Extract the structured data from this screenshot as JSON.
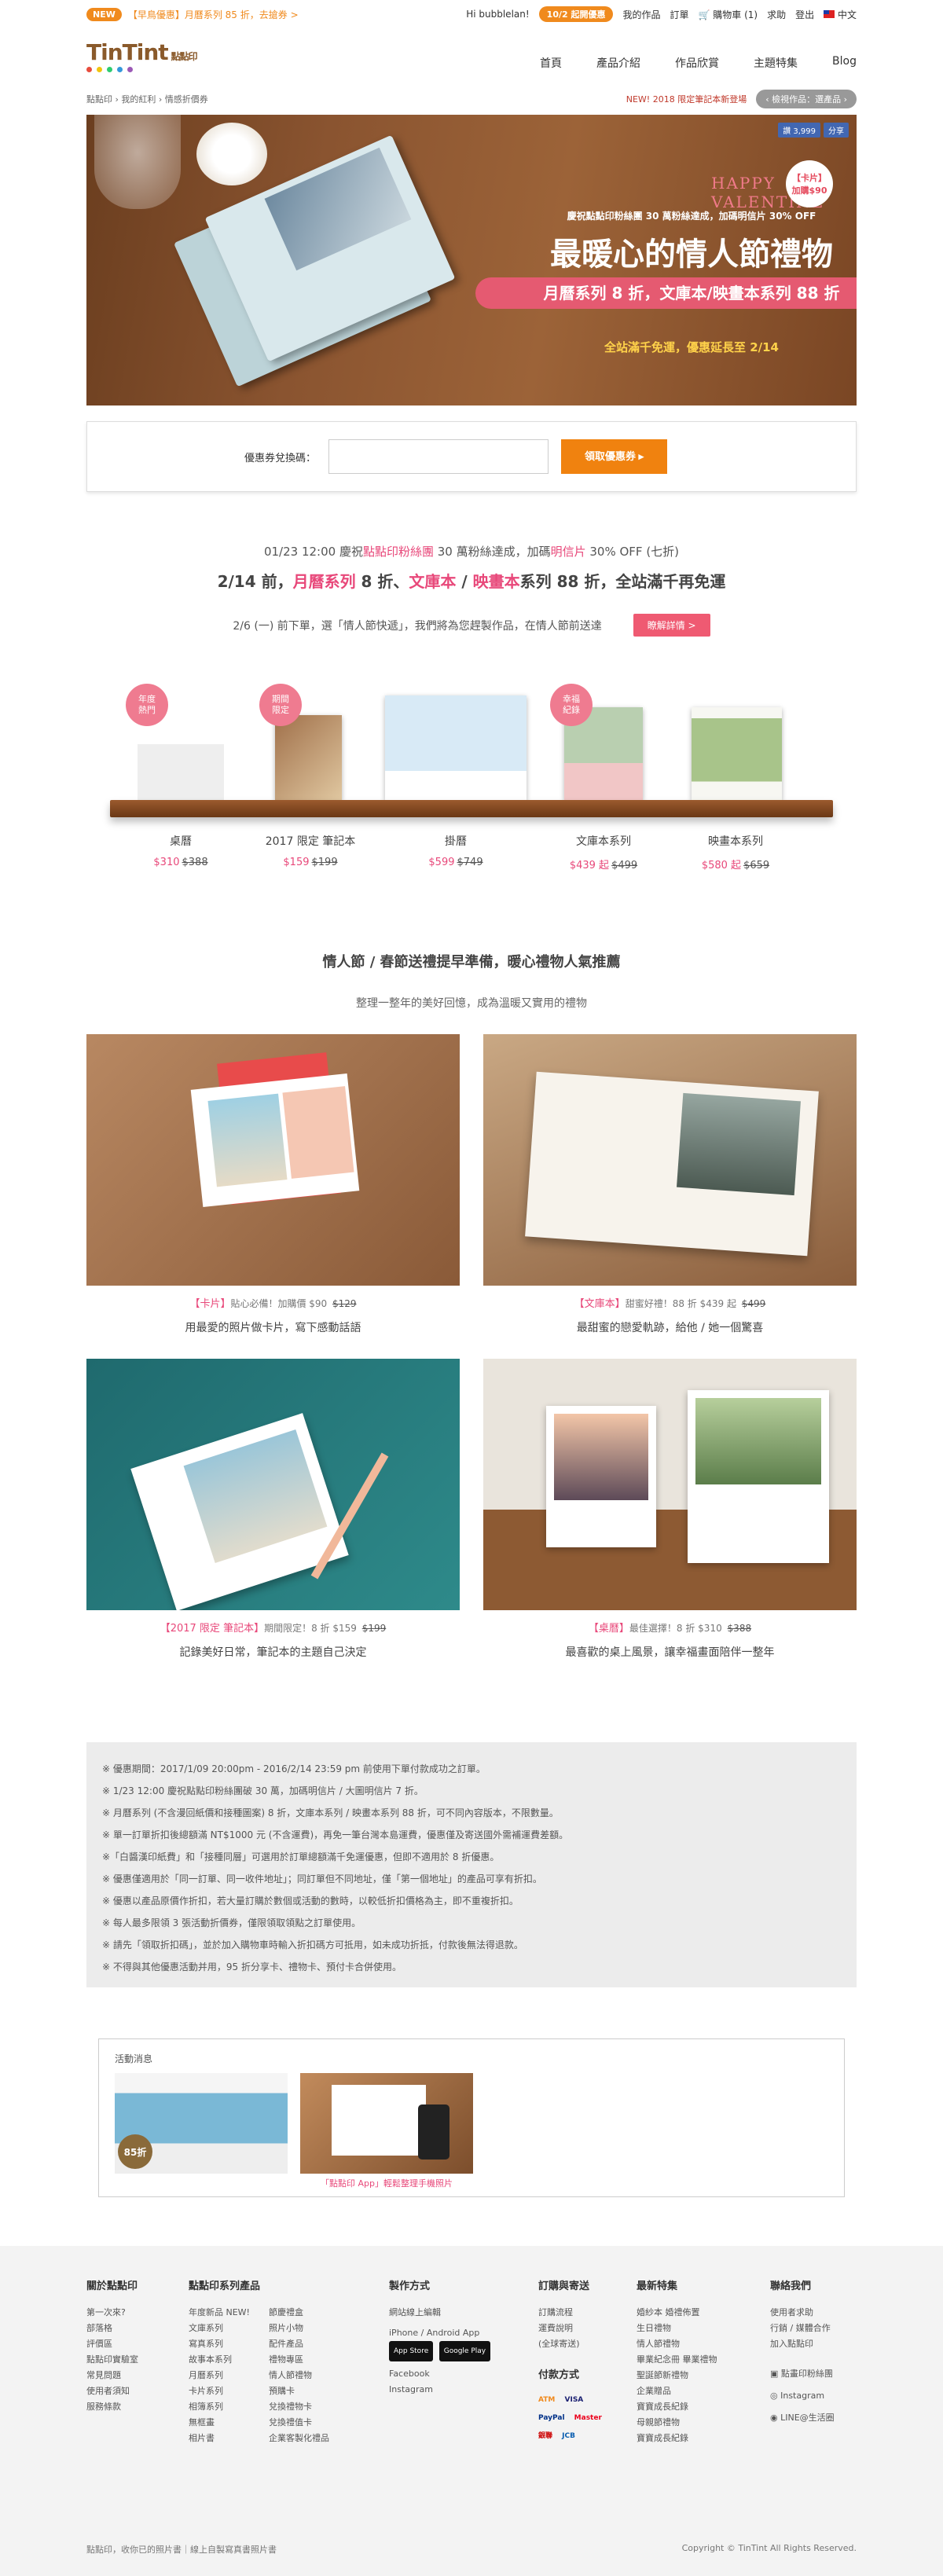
{
  "topbar": {
    "new_badge": "NEW",
    "promo_text": "【早鳥優惠】月曆系列 85 折，去搶券 >",
    "greeting": "Hi bubblelan!",
    "login_badge": "10/2 起開優惠",
    "links": [
      "我的作品",
      "訂單",
      "購物車 (1)",
      "求助",
      "登出"
    ],
    "language": "中文"
  },
  "header": {
    "logo_text": "TinTint",
    "logo_sub": "點點印",
    "logo_dot_colors": [
      "#e84c3d",
      "#f1c40f",
      "#2ecc71",
      "#3498db",
      "#9b59b6"
    ],
    "nav": [
      "首頁",
      "產品介紹",
      "作品欣賞",
      "主題特集",
      "Blog"
    ]
  },
  "breadcrumb": {
    "items": [
      "點點印",
      "我的紅利",
      "情感折價券"
    ],
    "new_link": "NEW! 2018 限定筆記本新登場",
    "pill": "‹ 檢視作品：選產品 ›"
  },
  "hero": {
    "happy_valentine": "HAPPY VALENTINE",
    "card_badge_top": "【卡片】",
    "card_badge_bottom": "加購$90",
    "line1": "慶祝點點印粉絲團 30 萬粉絲達成，加碼明信片 30% OFF",
    "line2": "最暖心的情人節禮物",
    "line3": "月曆系列 8 折，文庫本/映畫本系列 88 折",
    "line4": "全站滿千免運，優惠延長至 2/14",
    "like_label": "讚 3,999",
    "share_label": "分享"
  },
  "coupon": {
    "label": "優惠券兌換碼：",
    "input_value": "",
    "button": "領取優惠券 ▸"
  },
  "promo": {
    "p1_before": "01/23 12:00 慶祝",
    "p1_hl1": "點點印粉絲團",
    "p1_mid": " 30 萬粉絲達成，加碼",
    "p1_hl2": "明信片",
    "p1_after": " 30% OFF (七折)",
    "p2_a": "2/14 前，",
    "p2_hl1": "月曆系列",
    "p2_b": " 8 折、",
    "p2_hl2": "文庫本",
    "p2_c": " / ",
    "p2_hl3": "映畫本",
    "p2_d": "系列 88 折，全站滿千再免運",
    "p3": "2/6 (一) 前下單，選「情人節快遞」，我們將為您趕製作品，在情人節前送達",
    "p3_button": "瞭解詳情 >"
  },
  "shelf": [
    {
      "name": "桌曆",
      "price": "$310",
      "old": "$388",
      "badge": "年度\n熱門"
    },
    {
      "name": "2017 限定 筆記本",
      "price": "$159",
      "old": "$199",
      "badge": "期間\n限定"
    },
    {
      "name": "掛曆",
      "price": "$599",
      "old": "$749",
      "badge": ""
    },
    {
      "name": "文庫本系列",
      "price": "$439 起",
      "old": "$499",
      "badge": "幸福\n紀錄"
    },
    {
      "name": "映畫本系列",
      "price": "$580 起",
      "old": "$659",
      "badge": ""
    }
  ],
  "gifts": {
    "title": "情人節 / 春節送禮提早準備，暖心禮物人氣推薦",
    "subtitle": "整理一整年的美好回憶，成為溫暖又實用的禮物",
    "items": [
      {
        "tag": "【卡片】",
        "note": "貼心必備！加購價 $90",
        "old": "$129",
        "desc": "用最愛的照片做卡片，寫下感動話語"
      },
      {
        "tag": "【文庫本】",
        "note": "甜蜜好禮！88 折 $439 起",
        "old": "$499",
        "desc": "最甜蜜的戀愛軌跡，給他 / 她一個驚喜"
      },
      {
        "tag": "【2017 限定 筆記本】",
        "note": "期間限定！8 折 $159",
        "old": "$199",
        "desc": "記錄美好日常，筆記本的主題自己決定"
      },
      {
        "tag": "【桌曆】",
        "note": "最佳選擇！8 折 $310",
        "old": "$388",
        "desc": "最喜歡的桌上風景，讓幸福畫面陪伴一整年"
      }
    ]
  },
  "notes": [
    "※ 優惠期間：2017/1/09 20:00pm - 2016/2/14 23:59 pm 前使用下單付款成功之訂單。",
    "※ 1/23 12:00 慶祝點點印粉絲團破 30 萬，加碼明信片 / 大圖明信片 7 折。",
    "※ 月曆系列 (不含漫回紙價和接種圖案) 8 折，文庫本系列 / 映畫本系列 88 折，可不同內容版本，不限數量。",
    "※ 單一訂單折扣後總額滿 NT$1000 元 (不含運費)，再免一筆台灣本島運費，優惠僅及寄送國外需補運費差額。",
    "※「白醬漢印紙費」和「接種同層」可選用於訂單總額滿千免運優惠，但即不適用於 8 折優惠。",
    "※ 優惠僅適用於「同一訂單、同一收件地址」；同訂單但不同地址，僅「第一個地址」的產品可享有折扣。",
    "※ 優惠以產品原價作折扣，若大量訂購於數個或活動的數時，以較低折扣價格為主，即不重複折扣。",
    "※ 每人最多限領 3 張活動折價券，僅限領取領點之訂單使用。",
    "※ 請先「領取折扣碼」，並於加入購物車時輸入折扣碼方可抵用，如未成功折抵，付款後無法得退款。",
    "※ 不得與其他優惠活動并用，95 折分享卡、禮物卡、預付卡合併使用。"
  ],
  "activity": {
    "title": "活動消息",
    "items": [
      {
        "caption": "",
        "badge": "85折"
      },
      {
        "caption": "「點點印 App」輕鬆整理手機照片",
        "badge": ""
      }
    ]
  },
  "footer": {
    "cols": [
      {
        "title": "關於點點印",
        "items": [
          "第一次來?",
          "部落格",
          "評價區",
          "點點印實驗室",
          "常見問題",
          "使用者須知",
          "服務條款"
        ]
      },
      {
        "title": "點點印系列產品",
        "items": [
          "年度新品 NEW!",
          "文庫系列",
          "寫真系列",
          "故事本系列",
          "月曆系列",
          "卡片系列",
          "相簿系列",
          "無框畫",
          "相片書"
        ],
        "items2": [
          "節慶禮盒",
          "照片小物",
          "配件產品",
          "禮物專區",
          "情人節禮物",
          "預購卡",
          "兌換禮物卡",
          "兌換禮值卡",
          "企業客製化禮品"
        ]
      },
      {
        "title": "製作方式",
        "items": [
          "網站線上編輯",
          "iPhone / Android App",
          "",
          "Facebook",
          "Instagram"
        ],
        "stores": [
          "App Store",
          "Google Play"
        ]
      },
      {
        "title": "訂購與寄送",
        "items": [
          "訂購流程",
          "運費說明",
          "(全球寄送)"
        ],
        "sub": "付款方式",
        "pays": [
          "ATM",
          "VISA",
          "PayPal",
          "Master",
          "銀聯",
          "JCB"
        ]
      },
      {
        "title": "最新特集",
        "items": [
          "婚紗本 婚禮佈置",
          "生日禮物",
          "情人節禮物",
          "畢業紀念冊 畢業禮物",
          "聖誕節新禮物",
          "企業贈品",
          "寶寶成長紀錄",
          "母親節禮物",
          "寶寶成長紀錄"
        ]
      },
      {
        "title": "聯絡我們",
        "items": [
          "使用者求助",
          "行銷 / 媒體合作",
          "加入點點印"
        ],
        "socials": [
          "點畫印粉絲團",
          "Instagram",
          "LINE@生活圈"
        ]
      }
    ],
    "bottom_left": "點點印，收你已的照片書｜線上自製寫真書照片書",
    "bottom_right": "Copyright © TinTint All Rights Reserved."
  }
}
